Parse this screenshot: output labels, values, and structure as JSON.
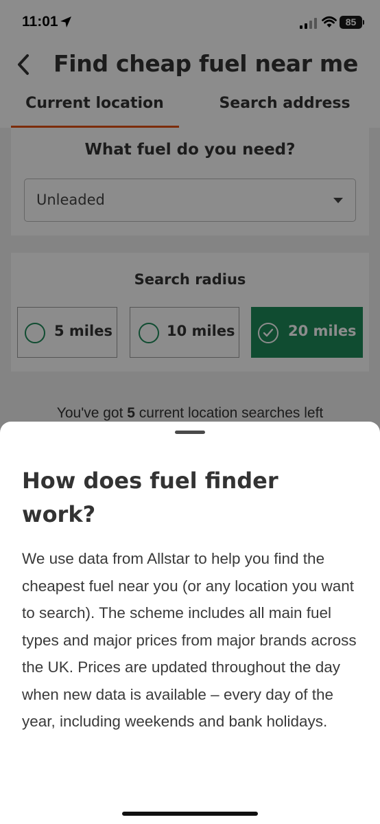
{
  "status_bar": {
    "time": "11:01",
    "battery": "85",
    "icons": [
      "location-arrow-icon",
      "signal-icon",
      "wifi-icon",
      "battery-icon"
    ]
  },
  "header": {
    "title": "Find cheap fuel near me",
    "back_icon": "chevron-left-icon"
  },
  "tabs": [
    {
      "label": "Current location",
      "selected": true
    },
    {
      "label": "Search address",
      "selected": false
    }
  ],
  "fuel": {
    "heading": "What fuel do you need?",
    "selected_value": "Unleaded"
  },
  "radius": {
    "heading": "Search radius",
    "options": [
      {
        "label": "5 miles",
        "selected": false
      },
      {
        "label": "10 miles",
        "selected": false
      },
      {
        "label": "20 miles",
        "selected": true
      }
    ]
  },
  "searches_left": {
    "prefix": "You've got ",
    "count": "5",
    "suffix": " current location searches left"
  },
  "sheet": {
    "title": "How does fuel finder work?",
    "body": "We use data from Allstar to help you find the cheapest fuel near you (or any location you want to search). The scheme includes all main fuel types and major prices from major brands across the UK. Prices are updated throughout the day when new data is available – every day of the year, including weekends and bank holidays."
  },
  "colors": {
    "accent_tab": "#e25012",
    "selected_green": "#1e8a5a",
    "overlay": "rgba(0,0,0,0.45)"
  }
}
